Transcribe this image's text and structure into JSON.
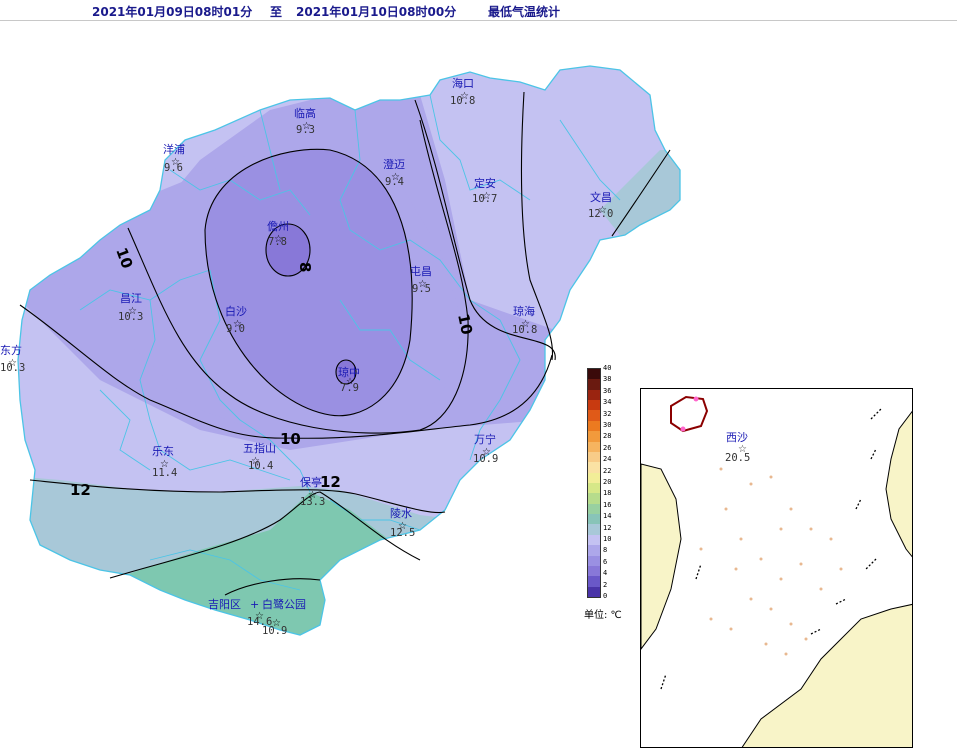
{
  "header": {
    "start": "2021年01月09日08时01分",
    "to": "至",
    "end": "2021年01月10日08时00分",
    "title": "最低气温统计"
  },
  "colors": {
    "c7": "#8878d8",
    "c8": "#9a90e2",
    "c9": "#ada7ea",
    "c10": "#c4c2f2",
    "c12": "#a8c8d8",
    "c13": "#7ec8b0",
    "land_border": "#4cc4e6",
    "inset_land": "#f8f4c8",
    "background": "#ffffff"
  },
  "isolines": [
    "10",
    "10",
    "10",
    "8",
    "12",
    "12"
  ],
  "stations": [
    {
      "name": "海口",
      "value": "10.8"
    },
    {
      "name": "临高",
      "value": "9.3"
    },
    {
      "name": "澄迈",
      "value": "9.4"
    },
    {
      "name": "定安",
      "value": "10.7"
    },
    {
      "name": "文昌",
      "value": "12.0"
    },
    {
      "name": "洋浦",
      "value": "9.6"
    },
    {
      "name": "儋州",
      "value": "7.8"
    },
    {
      "name": "屯昌",
      "value": "9.5"
    },
    {
      "name": "昌江",
      "value": "10.3"
    },
    {
      "name": "白沙",
      "value": "9.0"
    },
    {
      "name": "琼海",
      "value": "10.8"
    },
    {
      "name": "东方",
      "value": "10.3"
    },
    {
      "name": "琼中",
      "value": "7.9"
    },
    {
      "name": "乐东",
      "value": "11.4"
    },
    {
      "name": "五指山",
      "value": "10.4"
    },
    {
      "name": "万宁",
      "value": "10.9"
    },
    {
      "name": "保亭",
      "value": "13.3"
    },
    {
      "name": "陵水",
      "value": "12.5"
    },
    {
      "name": "吉阳区",
      "value": "14.6"
    },
    {
      "name": "白鹭公园",
      "value": "10.9"
    },
    {
      "name": "西沙",
      "value": "20.5"
    }
  ],
  "legend": {
    "unit": "单位: ℃",
    "ticks": [
      "40",
      "38",
      "36",
      "34",
      "32",
      "30",
      "28",
      "26",
      "24",
      "22",
      "20",
      "18",
      "16",
      "14",
      "12",
      "10",
      "8",
      "6",
      "4",
      "2",
      "0"
    ],
    "colors": [
      "#3a0a0a",
      "#6a1a10",
      "#9a2410",
      "#c83a10",
      "#e05a18",
      "#ec7a20",
      "#f29a3c",
      "#f6b460",
      "#f8cc88",
      "#fae2a4",
      "#f2ee98",
      "#d6e888",
      "#b6dc8c",
      "#98d0a0",
      "#88c4b8",
      "#a8c8d8",
      "#c4c2f2",
      "#ada7ea",
      "#9a90e2",
      "#8878d8",
      "#6a58c8",
      "#4a34a8"
    ]
  }
}
